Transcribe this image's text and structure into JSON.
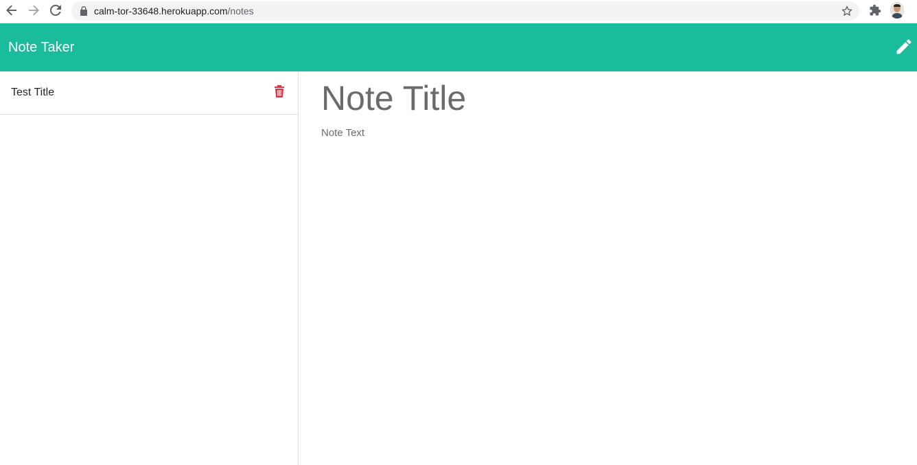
{
  "browser": {
    "url_host": "calm-tor-33648.herokuapp.com",
    "url_path": "/notes",
    "icons": {
      "back": "arrow-left-icon",
      "forward": "arrow-right-icon",
      "reload": "reload-icon",
      "lock": "lock-icon",
      "bookmark": "star-icon",
      "extensions": "puzzle-icon",
      "profile": "avatar"
    }
  },
  "navbar": {
    "brand": "Note Taker",
    "new_note_icon": "pencil-icon",
    "background_color": "#19bc9c"
  },
  "sidebar": {
    "notes": [
      {
        "title": "Test Title",
        "delete_icon": "trash-icon"
      }
    ],
    "delete_color": "#dc3545"
  },
  "editor": {
    "title_placeholder": "Note Title",
    "text_placeholder": "Note Text",
    "title_value": "",
    "text_value": ""
  }
}
